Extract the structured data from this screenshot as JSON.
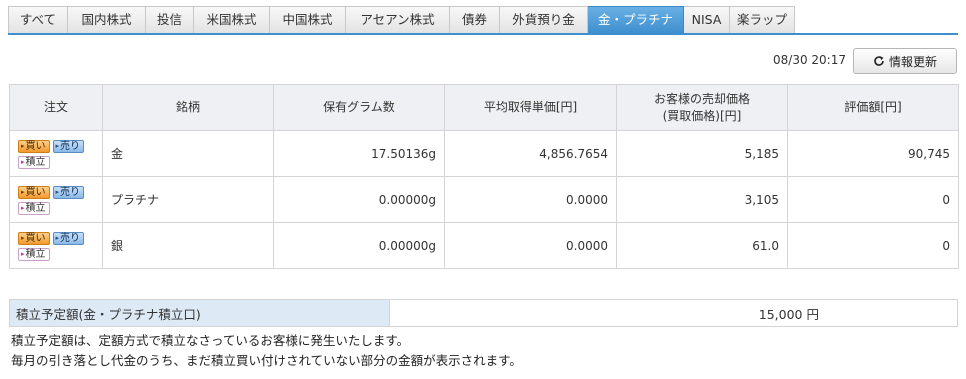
{
  "tabs": [
    {
      "label": "すべて",
      "active": false
    },
    {
      "label": "国内株式",
      "active": false
    },
    {
      "label": "投信",
      "active": false
    },
    {
      "label": "米国株式",
      "active": false
    },
    {
      "label": "中国株式",
      "active": false
    },
    {
      "label": "アセアン株式",
      "active": false
    },
    {
      "label": "債券",
      "active": false
    },
    {
      "label": "外貨預り金",
      "active": false
    },
    {
      "label": "金・プラチナ",
      "active": true
    },
    {
      "label": "NISA",
      "active": false
    },
    {
      "label": "楽ラップ",
      "active": false
    }
  ],
  "header": {
    "timestamp": "08/30 20:17",
    "refresh_label": "情報更新",
    "refresh_icon": "refresh-icon"
  },
  "holdings": {
    "columns": [
      "注文",
      "銘柄",
      "保有グラム数",
      "平均取得単価[円]",
      "お客様の売却価格",
      "(買取価格)[円]",
      "評価額[円]"
    ],
    "buttons": {
      "buy": "買い",
      "sell": "売り",
      "accumulate": "積立"
    },
    "rows": [
      {
        "name": "金",
        "grams": "17.50136g",
        "avg_price": "4,856.7654",
        "sell_price": "5,185",
        "valuation": "90,745"
      },
      {
        "name": "プラチナ",
        "grams": "0.00000g",
        "avg_price": "0.0000",
        "sell_price": "3,105",
        "valuation": "0"
      },
      {
        "name": "銀",
        "grams": "0.00000g",
        "avg_price": "0.0000",
        "sell_price": "61.0",
        "valuation": "0"
      }
    ]
  },
  "savings": {
    "label": "積立予定額(金・プラチナ積立口)",
    "amount": "15,000",
    "unit": "円"
  },
  "notes": [
    "積立予定額は、定額方式で積立なさっているお客様に発生いたします。",
    "毎月の引き落とし代金のうち、まだ積立買い付けされていない部分の金額が表示されます。"
  ],
  "colors": {
    "active_tab": "#4a9ad8",
    "buy_button": "#f29a2c",
    "sell_button": "#8cb8e8",
    "savings_label_bg": "#dde9f4",
    "header_bg": "#eef0f3"
  }
}
